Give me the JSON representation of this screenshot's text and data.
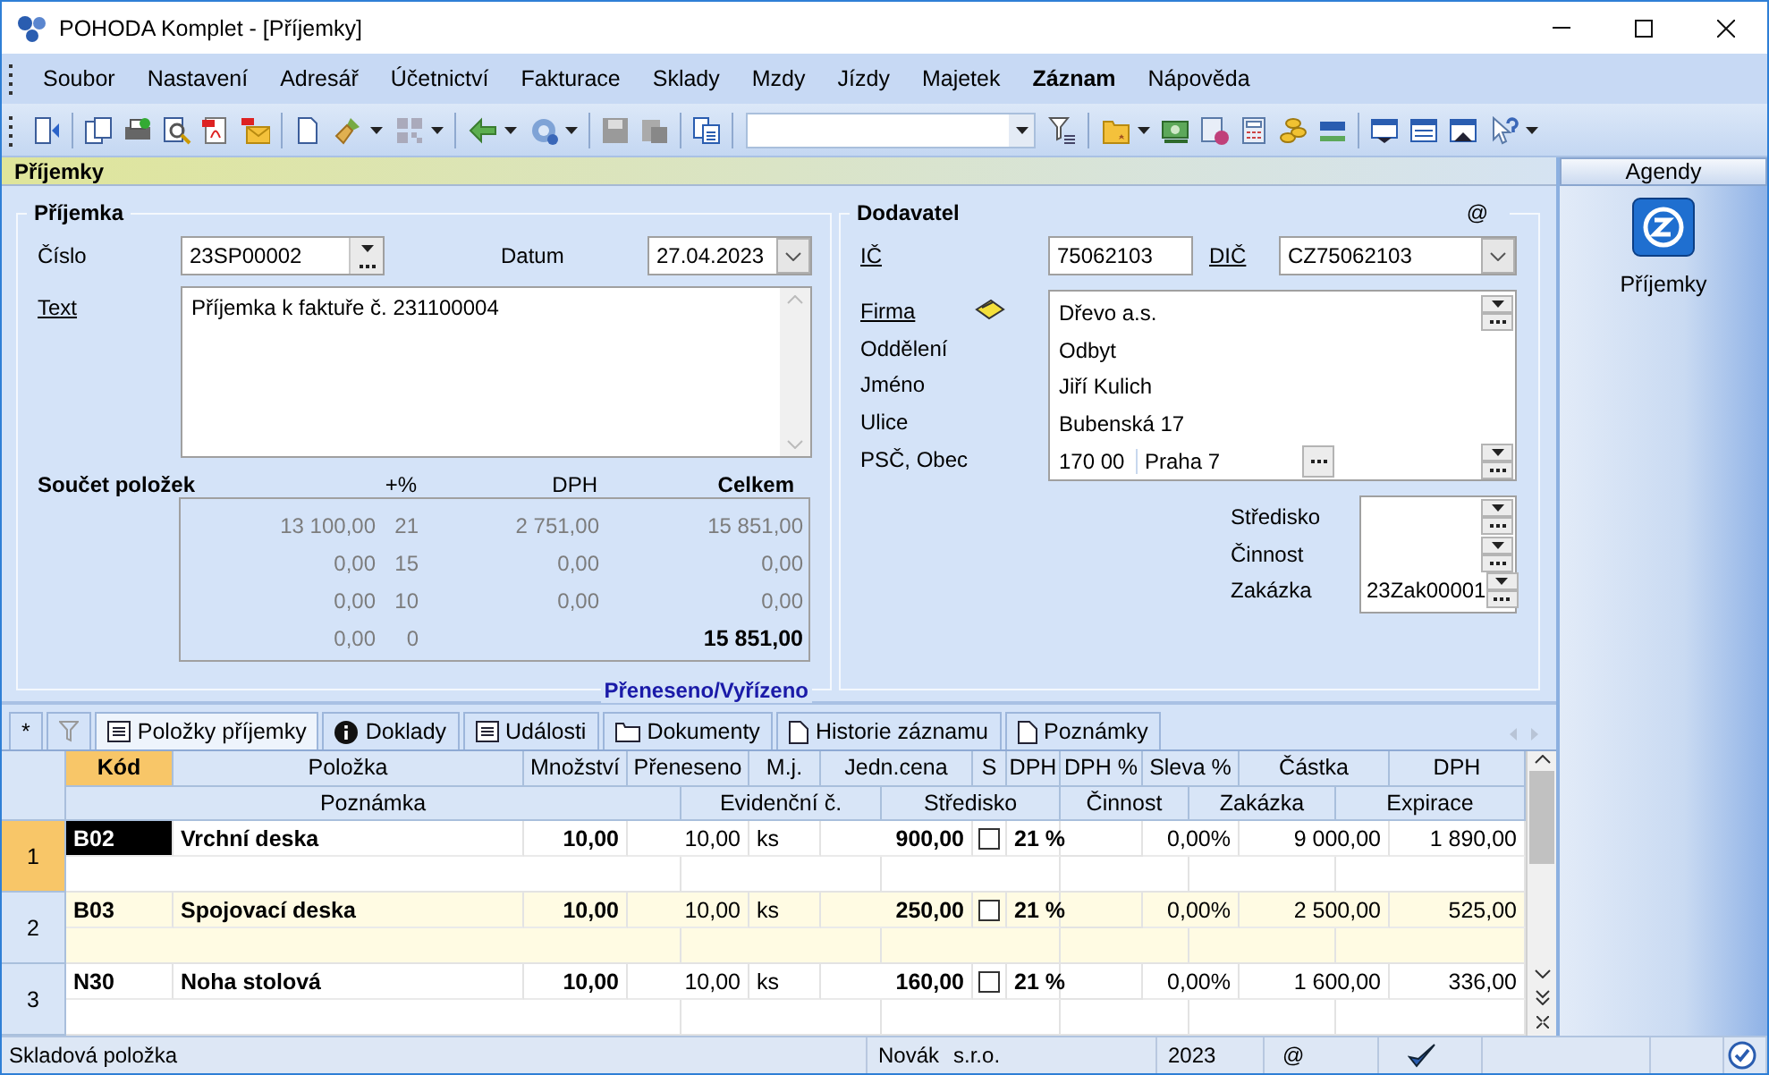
{
  "window": {
    "title": "POHODA Komplet - [Příjemky]"
  },
  "menu": [
    {
      "label": "Soubor",
      "bold": false
    },
    {
      "label": "Nastavení",
      "bold": false
    },
    {
      "label": "Adresář",
      "bold": false
    },
    {
      "label": "Účetnictví",
      "bold": false
    },
    {
      "label": "Fakturace",
      "bold": false
    },
    {
      "label": "Sklady",
      "bold": false
    },
    {
      "label": "Mzdy",
      "bold": false
    },
    {
      "label": "Jízdy",
      "bold": false
    },
    {
      "label": "Majetek",
      "bold": false
    },
    {
      "label": "Záznam",
      "bold": true
    },
    {
      "label": "Nápověda",
      "bold": false
    }
  ],
  "agenda_title": "Příjemky",
  "receipt": {
    "title": "Příjemka",
    "number_label": "Číslo",
    "number": "23SP00002",
    "date_label": "Datum",
    "date": "27.04.2023",
    "text_label": "Text",
    "text": "Příjemka k faktuře č. 231100004"
  },
  "summary": {
    "title": "Součet položek",
    "columns": [
      "+%",
      "DPH",
      "Celkem"
    ],
    "rows": [
      {
        "base": "13 100,00",
        "rate": "21",
        "vat": "2 751,00",
        "total": "15 851,00",
        "bold": false
      },
      {
        "base": "0,00",
        "rate": "15",
        "vat": "0,00",
        "total": "0,00",
        "bold": false
      },
      {
        "base": "0,00",
        "rate": "10",
        "vat": "0,00",
        "total": "0,00",
        "bold": false
      },
      {
        "base": "0,00",
        "rate": "0",
        "total": "15 851,00",
        "bold": true
      }
    ]
  },
  "transfer_label": "Přeneseno/Vyřízeno",
  "supplier": {
    "title": "Dodavatel",
    "email_mark": "@",
    "ic_label": "IČ",
    "ic": "75062103",
    "dic_label": "DIČ",
    "dic": "CZ75062103",
    "address": [
      {
        "label": "Firma",
        "value": "Dřevo a.s."
      },
      {
        "label": "Oddělení",
        "value": "Odbyt"
      },
      {
        "label": "Jméno",
        "value": "Jiří Kulich"
      },
      {
        "label": "Ulice",
        "value": "Bubenská 17"
      }
    ],
    "city_label": "PSČ, Obec",
    "zip": "170 00",
    "city": "Praha 7"
  },
  "assignment": [
    {
      "label": "Středisko"
    },
    {
      "label": "Činnost"
    },
    {
      "label": "Zakázka",
      "value": "23Zak00001"
    }
  ],
  "sidebar": {
    "title": "Agendy",
    "items": [
      {
        "label": "Příjemky"
      }
    ]
  },
  "tab_bar": {
    "new_marker": "*"
  },
  "tabs": [
    {
      "label": "Položky příjemky",
      "kind": "list",
      "selected": true
    },
    {
      "label": "Doklady",
      "kind": "info",
      "selected": false
    },
    {
      "label": "Události",
      "kind": "list",
      "selected": false
    },
    {
      "label": "Dokumenty",
      "kind": "folder",
      "selected": false
    },
    {
      "label": "Historie záznamu",
      "kind": "page",
      "selected": false
    },
    {
      "label": "Poznámky",
      "kind": "page",
      "selected": false
    }
  ],
  "table": {
    "columns": [
      {
        "label": "Kód",
        "selected": true
      },
      {
        "label": "Položka",
        "selected": false
      },
      {
        "label": "Množství",
        "selected": false
      },
      {
        "label": "Přeneseno",
        "selected": false
      },
      {
        "label": "M.j.",
        "selected": false
      },
      {
        "label": "Jedn.cena",
        "selected": false
      },
      {
        "label": "S",
        "selected": false
      },
      {
        "label": "DPH",
        "selected": false
      },
      {
        "label": "DPH %",
        "selected": false
      },
      {
        "label": "Sleva %",
        "selected": false
      },
      {
        "label": "Částka",
        "selected": false
      },
      {
        "label": "DPH",
        "selected": false
      }
    ],
    "subcolumns": [
      "Poznámka",
      "Evidenční č.",
      "Středisko",
      "Činnost",
      "Zakázka",
      "Expirace"
    ],
    "rows": [
      {
        "number": "1",
        "selected": true,
        "code": "B02",
        "item": "Vrchní deska",
        "quantity": "10,00",
        "transferred": "10,00",
        "unit": "ks",
        "price": "900,00",
        "s_checked": false,
        "vat": "21 %",
        "discount": "0,00%",
        "amount": "9 000,00",
        "vat_amount": "1 890,00"
      },
      {
        "number": "2",
        "selected": false,
        "code": "B03",
        "item": "Spojovací deska",
        "quantity": "10,00",
        "transferred": "10,00",
        "unit": "ks",
        "price": "250,00",
        "s_checked": false,
        "vat": "21 %",
        "discount": "0,00%",
        "amount": "2 500,00",
        "vat_amount": "525,00"
      },
      {
        "number": "3",
        "selected": false,
        "code": "N30",
        "item": "Noha stolová",
        "quantity": "10,00",
        "transferred": "10,00",
        "unit": "ks",
        "price": "160,00",
        "s_checked": false,
        "vat": "21 %",
        "discount": "0,00%",
        "amount": "1 600,00",
        "vat_amount": "336,00"
      }
    ]
  },
  "status_bar": {
    "message": "Skladová položka",
    "user": "Novák",
    "company": "s.r.o.",
    "year": "2023",
    "email": "@"
  }
}
